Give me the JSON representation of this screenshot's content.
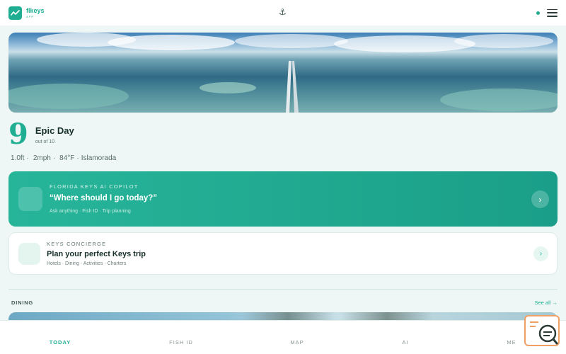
{
  "header": {
    "logo_name": "flkeys",
    "logo_sub": "APP",
    "center_icon": "anchor-icon",
    "status_color": "#1fae92",
    "menu_icon": "hamburger-icon"
  },
  "hero": {
    "image": "aerial seven mile bridge over turquoise water"
  },
  "score": {
    "value": "9",
    "label": "Epic Day",
    "sub": "out of 10"
  },
  "conditions": {
    "wave_icon": "",
    "wave": "1.0ft",
    "sep1": "·",
    "wind_icon": "",
    "wind": "2mph",
    "sep2": "·",
    "temp_icon": "",
    "temp": "84°F",
    "sep3": "·",
    "location": "Islamorada"
  },
  "copilot": {
    "icon_glyph": "",
    "eyebrow": "FLORIDA KEYS AI COPILOT",
    "title": "“Where should I go today?”",
    "meta": "Ask anything · Fish ID · Trip planning",
    "arrow": "›"
  },
  "concierge": {
    "icon_glyph": "",
    "eyebrow": "KEYS CONCIERGE",
    "title": "Plan your perfect Keys trip",
    "meta": "Hotels · Dining · Activities · Charters",
    "arrow": "›"
  },
  "dining_section": {
    "icon_glyph": "",
    "label": "DINING",
    "see_all": "See all →"
  },
  "bottom_nav": [
    {
      "label": "TODAY",
      "icon_glyph": "",
      "active": true
    },
    {
      "label": "FISH ID",
      "icon_glyph": "",
      "active": false
    },
    {
      "label": "MAP",
      "icon_glyph": "",
      "active": false
    },
    {
      "label": "AI",
      "icon_glyph": "",
      "active": false
    },
    {
      "label": "ME",
      "icon_glyph": "",
      "active": false
    }
  ],
  "colors": {
    "accent": "#1fae92",
    "background": "#eef7f5",
    "widget_border": "#f0a065"
  }
}
